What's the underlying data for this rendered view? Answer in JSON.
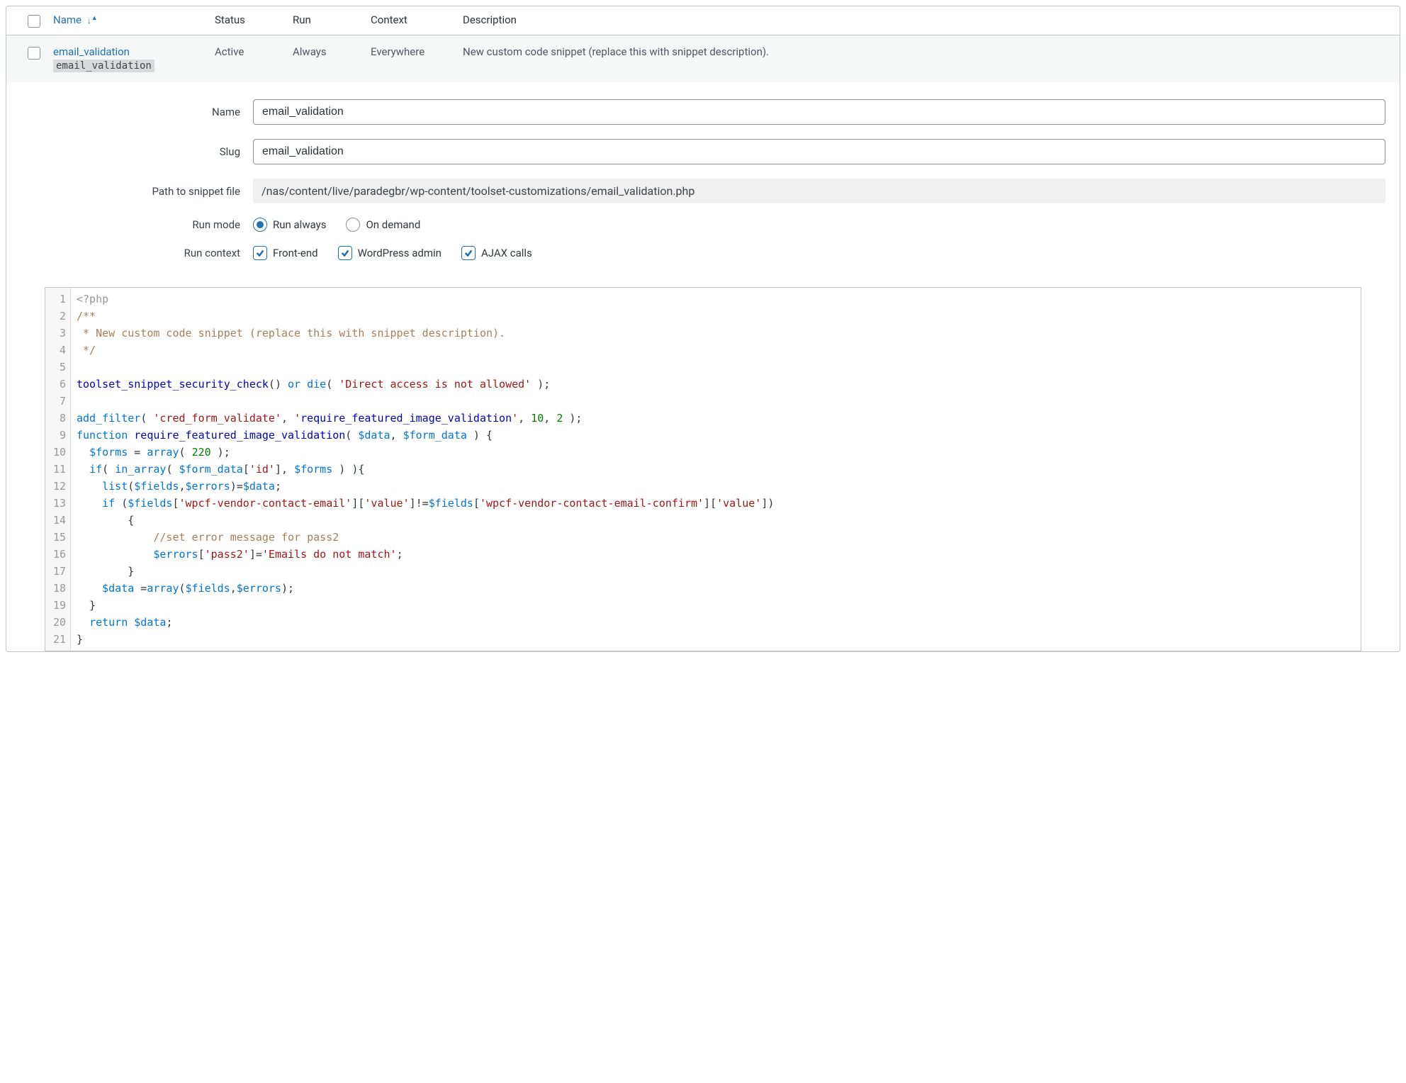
{
  "table": {
    "headers": {
      "name": "Name",
      "status": "Status",
      "run": "Run",
      "context": "Context",
      "description": "Description"
    },
    "row": {
      "title": "email_validation",
      "sublabel": "email_validation",
      "status": "Active",
      "run": "Always",
      "context": "Everywhere",
      "description": "New custom code snippet (replace this with snippet description)."
    }
  },
  "form": {
    "labels": {
      "name": "Name",
      "slug": "Slug",
      "path": "Path to snippet file",
      "run_mode": "Run mode",
      "run_context": "Run context"
    },
    "values": {
      "name": "email_validation",
      "slug": "email_validation",
      "path": "/nas/content/live/paradegbr/wp-content/toolset-customizations/email_validation.php"
    },
    "run_mode": {
      "always": "Run always",
      "on_demand": "On demand",
      "selected": "always"
    },
    "run_context": {
      "front_end": "Front-end",
      "wp_admin": "WordPress admin",
      "ajax": "AJAX calls",
      "checked": [
        "front_end",
        "wp_admin",
        "ajax"
      ]
    }
  },
  "code": {
    "line_count": 21,
    "lines": [
      "<?php",
      "/**",
      " * New custom code snippet (replace this with snippet description).",
      " */",
      "",
      "toolset_snippet_security_check() or die( 'Direct access is not allowed' );",
      "",
      "add_filter( 'cred_form_validate', 'require_featured_image_validation', 10, 2 );",
      "function require_featured_image_validation( $data, $form_data ) {",
      "  $forms = array( 220 );",
      "  if( in_array( $form_data['id'], $forms ) ){",
      "    list($fields,$errors)=$data;",
      "    if ($fields['wpcf-vendor-contact-email']['value']!=$fields['wpcf-vendor-contact-email-confirm']['value'])",
      "        {",
      "            //set error message for pass2",
      "            $errors['pass2']='Emails do not match';",
      "        }",
      "    $data =array($fields,$errors);",
      "  }",
      "  return $data;",
      "}"
    ]
  }
}
